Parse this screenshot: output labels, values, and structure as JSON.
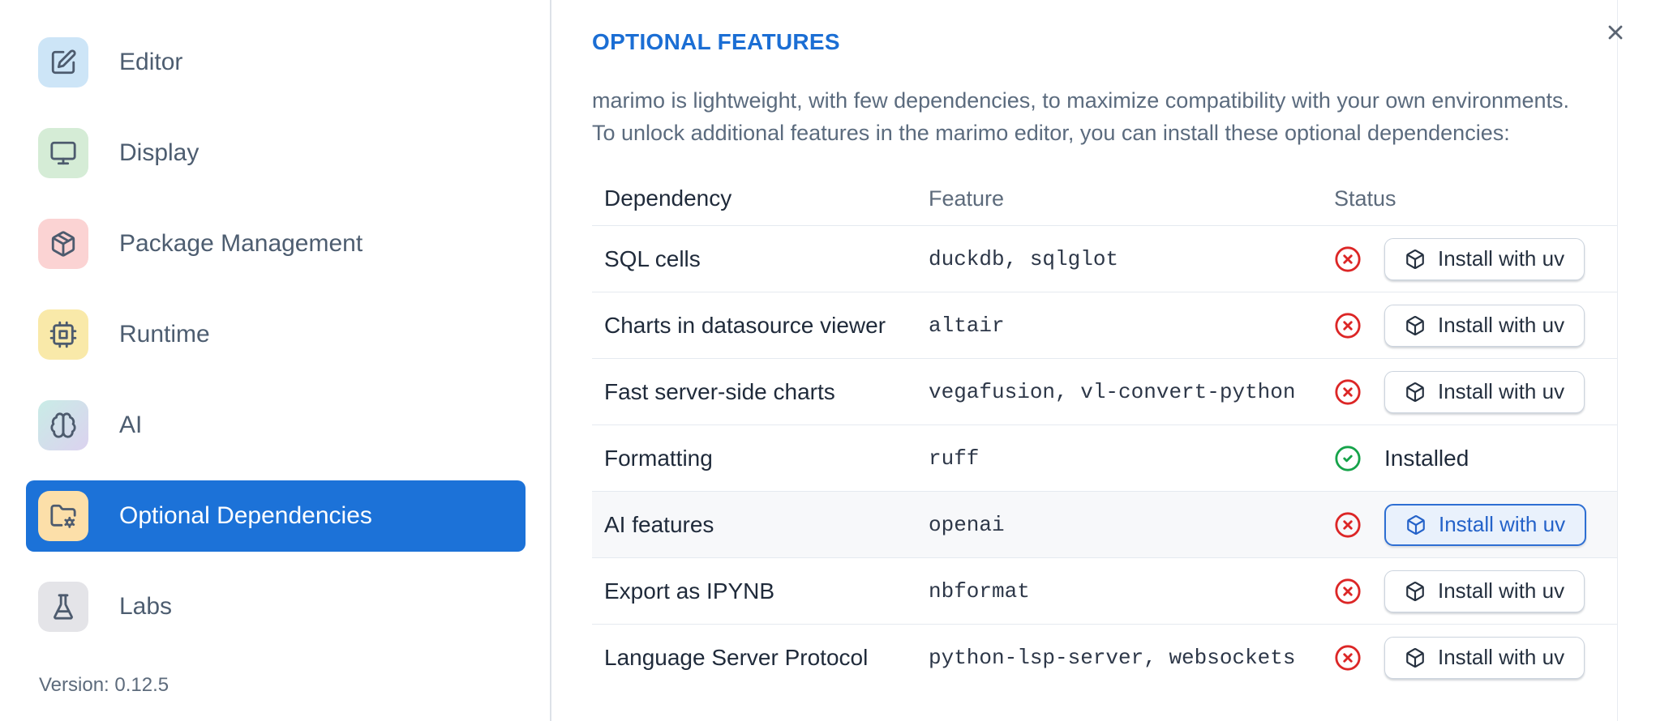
{
  "colors": {
    "accent_blue": "#1c72d8",
    "title_blue": "#1b6ed4",
    "status_red": "#dc2626",
    "status_green": "#16a34a",
    "focused_button_bg": "#e9f1fc",
    "focused_button_border": "#2e6fd3",
    "ai_tile_gradient": [
      "#c9ece6",
      "#dbd2ef"
    ]
  },
  "sidebar": {
    "items": [
      {
        "label": "Editor",
        "icon": "pencil-square-icon",
        "tile_color": "#cde5f7",
        "selected": false
      },
      {
        "label": "Display",
        "icon": "monitor-icon",
        "tile_color": "#d5ecd6",
        "selected": false
      },
      {
        "label": "Package Management",
        "icon": "package-icon",
        "tile_color": "#fbd3d3",
        "selected": false
      },
      {
        "label": "Runtime",
        "icon": "cpu-icon",
        "tile_color": "#f9e9a9",
        "selected": false
      },
      {
        "label": "AI",
        "icon": "brain-icon",
        "tile_color": "gradient",
        "selected": false
      },
      {
        "label": "Optional Dependencies",
        "icon": "folder-cog-icon",
        "tile_color": "#fcdfa9",
        "selected": true
      },
      {
        "label": "Labs",
        "icon": "flask-icon",
        "tile_color": "#e4e4e8",
        "selected": false
      }
    ],
    "version_label": "Version: 0.12.5"
  },
  "dialog": {
    "close_icon": "x-icon",
    "title": "OPTIONAL FEATURES",
    "description_line1": "marimo is lightweight, with few dependencies, to maximize compatibility with your own environments.",
    "description_line2": "To unlock additional features in the marimo editor, you can install these optional dependencies:",
    "table": {
      "headers": {
        "dependency": "Dependency",
        "feature": "Feature",
        "status": "Status"
      },
      "rows": [
        {
          "dependency": "SQL cells",
          "feature": "duckdb, sqlglot",
          "installed": false,
          "action": "Install with uv",
          "highlighted": false
        },
        {
          "dependency": "Charts in datasource viewer",
          "feature": "altair",
          "installed": false,
          "action": "Install with uv",
          "highlighted": false
        },
        {
          "dependency": "Fast server-side charts",
          "feature": "vegafusion, vl-convert-python",
          "installed": false,
          "action": "Install with uv",
          "highlighted": false
        },
        {
          "dependency": "Formatting",
          "feature": "ruff",
          "installed": true,
          "status_label": "Installed",
          "highlighted": false
        },
        {
          "dependency": "AI features",
          "feature": "openai",
          "installed": false,
          "action": "Install with uv",
          "highlighted": true
        },
        {
          "dependency": "Export as IPYNB",
          "feature": "nbformat",
          "installed": false,
          "action": "Install with uv",
          "highlighted": false
        },
        {
          "dependency": "Language Server Protocol",
          "feature": "python-lsp-server, websockets",
          "installed": false,
          "action": "Install with uv",
          "highlighted": false
        }
      ]
    }
  }
}
